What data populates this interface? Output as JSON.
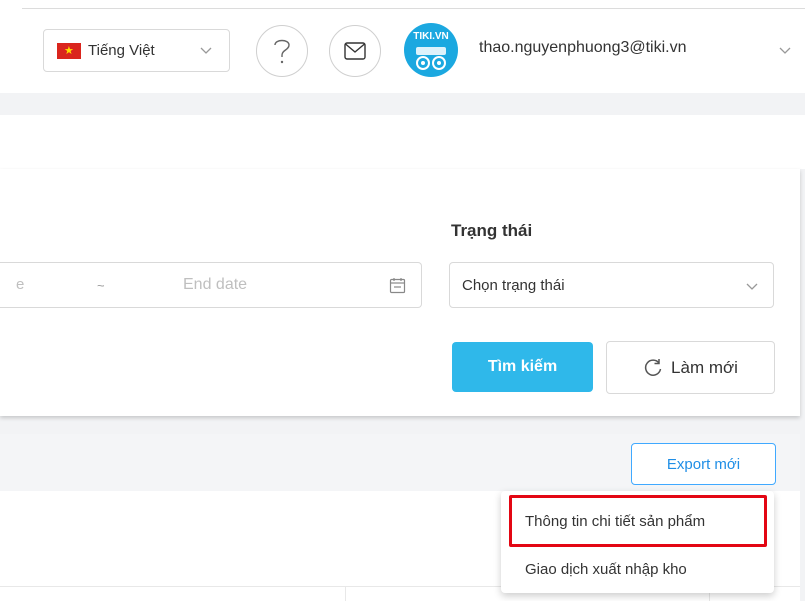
{
  "header": {
    "language": {
      "label": "Tiếng Việt",
      "flag_star": "★"
    },
    "help_icon": "question-mark-icon",
    "mail_icon": "envelope-icon",
    "avatar_text": "TIKI.VN",
    "user_email": "thao.nguyenphuong3@tiki.vn"
  },
  "filter": {
    "start_date_placeholder": "e",
    "date_separator": "~",
    "end_date_placeholder": "End date",
    "status_label": "Trạng thái",
    "status_placeholder": "Chọn trạng thái",
    "search_label": "Tìm kiếm",
    "reset_label": "Làm mới"
  },
  "results": {
    "export_label": "Export mới",
    "export_menu": [
      {
        "label": "Thông tin chi tiết sản phẩm"
      },
      {
        "label": "Giao dịch xuất nhập kho"
      }
    ]
  },
  "colors": {
    "primary": "#2fb8ea",
    "link": "#1f8ee6",
    "highlight": "#e30613"
  }
}
